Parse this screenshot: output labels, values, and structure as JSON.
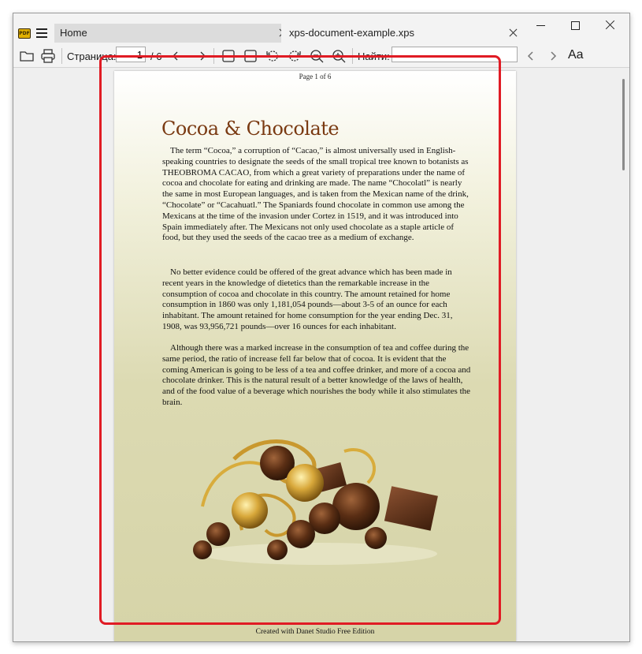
{
  "app": {
    "icon_text": "PDF",
    "icon_name": "pdf-app-icon",
    "accent_color": "#e0b000"
  },
  "tabs": [
    {
      "label": "Home",
      "active": false
    },
    {
      "label": "xps-document-example.xps",
      "active": true
    }
  ],
  "toolbar": {
    "page_label": "Страница:",
    "page_value": "1",
    "page_total": "/ 6",
    "find_label": "Найти:",
    "find_value": "",
    "font_button": "Aa"
  },
  "document": {
    "page_indicator": "Page 1 of 6",
    "title": "Cocoa & Chocolate",
    "title_color": "#7a3a12",
    "paragraphs": [
      "The term “Cocoa,” a corruption of “Cacao,” is almost universally used in English-speaking countries to designate the seeds of the small tropical tree known to botanists as THEOBROMA CACAO, from which a great variety of preparations under the name of cocoa and chocolate for eating and drinking are made. The name “Chocolatl” is nearly the same in most European languages, and is taken from the Mexican name of the drink, “Chocolate” or “Cacahuatl.” The Spaniards found chocolate in common use among the Mexicans at the time of the invasion under Cortez in 1519, and it was introduced into Spain immediately after. The Mexicans not only used chocolate as a staple article of food, but they used the seeds of the cacao tree as a medium of exchange.",
      "No better evidence could be offered of the great advance which has been made in recent years in the knowledge of dietetics than the remarkable increase in the consumption of cocoa and chocolate in this country. The amount retained for home consumption in 1860 was only 1,181,054 pounds—about 3-5 of an ounce for each inhabitant. The amount retained for home consumption for the year ending Dec. 31, 1908, was 93,956,721 pounds—over 16 ounces for each inhabitant.",
      "Although there was a marked increase in the consumption of tea and coffee during the same period, the ratio of increase fell far below that of cocoa. It is evident that the coming American is going to be less of a tea and coffee drinker, and more of a cocoa and chocolate drinker. This is the natural result of a better knowledge of the laws of health, and of the food value of a beverage which nourishes the body while it also stimulates the brain."
    ],
    "footer": "Created with Danet Studio Free Edition",
    "highlight_color": "#e01b24"
  }
}
